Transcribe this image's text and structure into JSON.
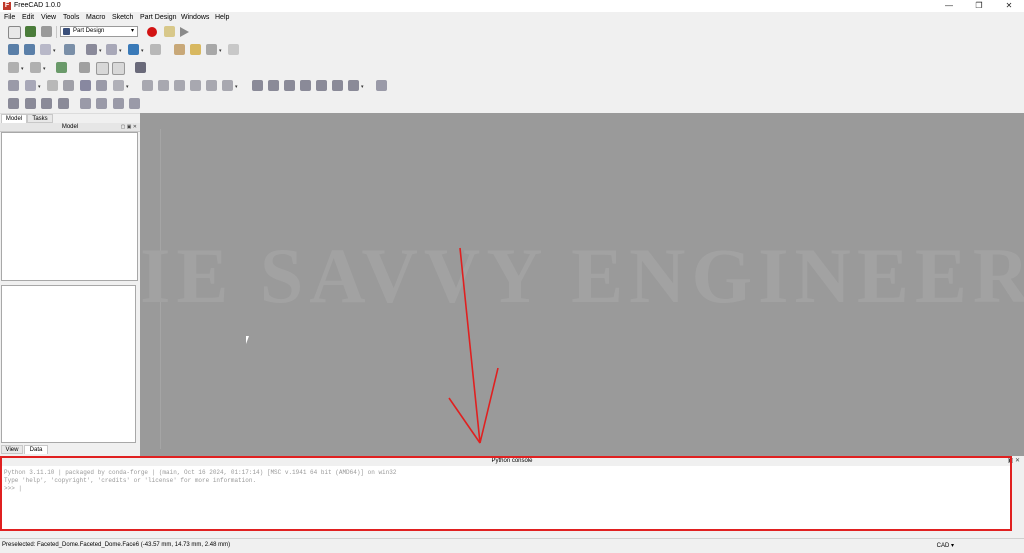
{
  "window": {
    "title": "FreeCAD 1.0.0",
    "app_icon_letter": "F",
    "minimize": "—",
    "restore": "❐",
    "close": "✕"
  },
  "menu": [
    "File",
    "Edit",
    "View",
    "Tools",
    "Macro",
    "Sketch",
    "Part Design",
    "Windows",
    "Help"
  ],
  "toolbar": {
    "workbench": "Part Design"
  },
  "combo_view": {
    "tabs": [
      "Model",
      "Tasks"
    ],
    "model_header": "Model",
    "property_tabs": [
      "View",
      "Data"
    ]
  },
  "viewport": {
    "watermark": "IE SAVVY ENGINEER"
  },
  "console": {
    "title": "Python console",
    "lines": [
      "Python 3.11.10 | packaged by conda-forge | (main, Oct 16 2024, 01:17:14) [MSC v.1941 64 bit (AMD64)] on win32",
      "Type 'help', 'copyright', 'credits' or 'license' for more information.",
      ">>> |"
    ]
  },
  "status": {
    "preselected": "Preselected: Faceted_Dome.Faceted_Dome.Face6 (-43.57 mm, 14.73 mm, 2.48 mm)",
    "nav_style": "CAD ▾"
  },
  "colors": {
    "annotation_red": "#e02020",
    "viewport_bg": "#9a9a9a",
    "record_red": "#d21313"
  }
}
